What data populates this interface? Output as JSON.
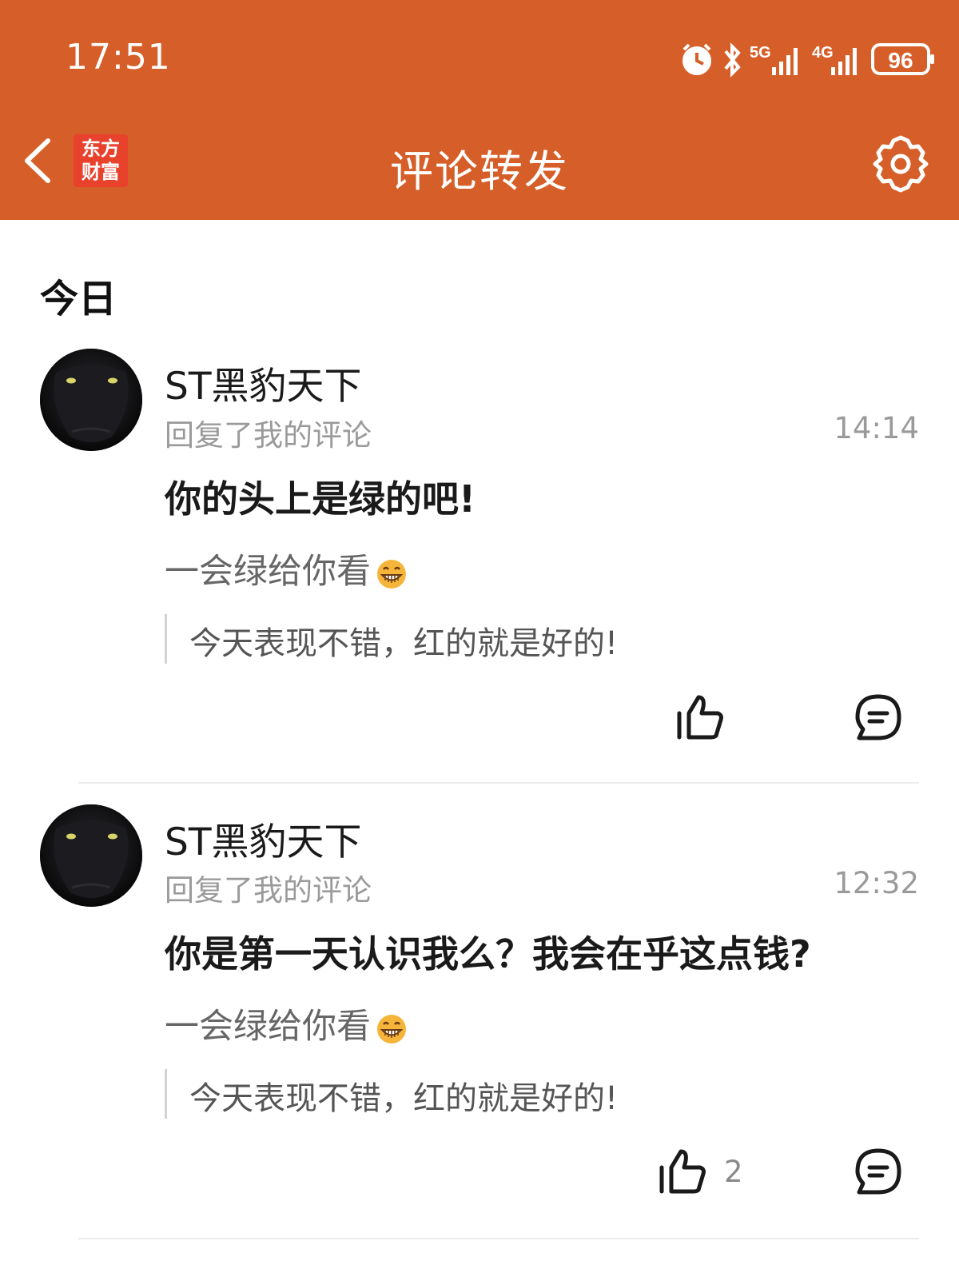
{
  "status_bar": {
    "time": "17:51",
    "network_1": "5G",
    "network_2": "4G",
    "battery": "96",
    "icons": [
      "alarm-icon",
      "bluetooth-icon",
      "signal-icon",
      "signal-icon",
      "battery-icon"
    ]
  },
  "header": {
    "title": "评论转发",
    "logo_line1": "东方",
    "logo_line2": "财富",
    "back_icon": "chevron-left-icon",
    "settings_icon": "gear-icon",
    "bg_color": "#d65f29"
  },
  "section": {
    "label": "今日"
  },
  "items": [
    {
      "author": "ST黑豹天下",
      "action": "回复了我的评论",
      "time": "14:14",
      "reply": "你的头上是绿的吧!",
      "my_comment": "一会绿给你看",
      "quote": "今天表现不错，红的就是好的!",
      "like_count": ""
    },
    {
      "author": "ST黑豹天下",
      "action": "回复了我的评论",
      "time": "12:32",
      "reply": "你是第一天认识我么？我会在乎这点钱?",
      "my_comment": "一会绿给你看",
      "quote": "今天表现不错，红的就是好的!",
      "like_count": "2"
    }
  ]
}
